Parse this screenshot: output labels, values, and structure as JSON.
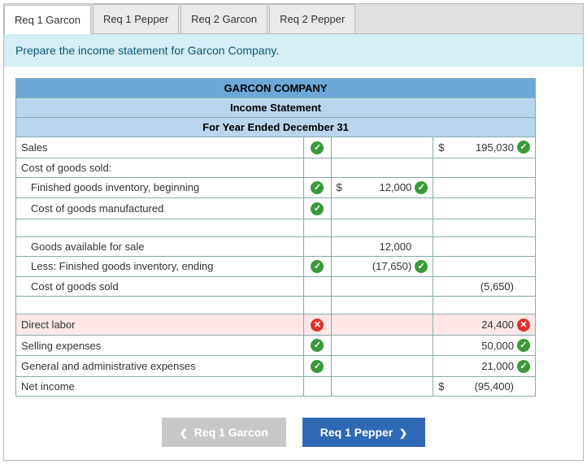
{
  "tabs": [
    {
      "label": "Req 1 Garcon",
      "active": true
    },
    {
      "label": "Req 1 Pepper",
      "active": false
    },
    {
      "label": "Req 2 Garcon",
      "active": false
    },
    {
      "label": "Req 2 Pepper",
      "active": false
    }
  ],
  "instruction": "Prepare the income statement for Garcon Company.",
  "header": {
    "company": "GARCON COMPANY",
    "title": "Income Statement",
    "period": "For Year Ended December 31"
  },
  "rows": {
    "sales": {
      "label": "Sales",
      "mark": "ok",
      "cur2": "$",
      "amt2": "195,030",
      "mark2": "ok"
    },
    "cogs_header": {
      "label": "Cost of goods sold:"
    },
    "fg_begin": {
      "label": "Finished goods inventory, beginning",
      "mark": "ok",
      "cur1": "$",
      "amt1": "12,000",
      "mark1": "ok"
    },
    "cogm": {
      "label": "Cost of goods manufactured",
      "mark": "ok"
    },
    "gafs": {
      "label": "Goods available for sale",
      "amt1": "12,000"
    },
    "fg_end": {
      "label": "Less: Finished goods inventory, ending",
      "mark": "ok",
      "amt1": "(17,650)",
      "mark1": "ok"
    },
    "cogs": {
      "label": "Cost of goods sold",
      "amt2": "(5,650)"
    },
    "direct_labor": {
      "label": "Direct labor",
      "mark": "bad",
      "amt2": "24,400",
      "mark2": "bad"
    },
    "selling": {
      "label": "Selling expenses",
      "mark": "ok",
      "amt2": "50,000",
      "mark2": "ok"
    },
    "ga": {
      "label": "General and administrative expenses",
      "mark": "ok",
      "amt2": "21,000",
      "mark2": "ok"
    },
    "net": {
      "label": "Net income",
      "cur2": "$",
      "amt2": "(95,400)"
    }
  },
  "nav": {
    "prev": "Req 1 Garcon",
    "next": "Req 1 Pepper"
  },
  "chart_data": {
    "type": "table",
    "title": "GARCON COMPANY Income Statement For Year Ended December 31",
    "data": [
      {
        "item": "Sales",
        "col1": null,
        "col2": 195030
      },
      {
        "item": "Finished goods inventory, beginning",
        "col1": 12000,
        "col2": null
      },
      {
        "item": "Cost of goods manufactured",
        "col1": null,
        "col2": null
      },
      {
        "item": "Goods available for sale",
        "col1": 12000,
        "col2": null
      },
      {
        "item": "Less: Finished goods inventory, ending",
        "col1": -17650,
        "col2": null
      },
      {
        "item": "Cost of goods sold",
        "col1": null,
        "col2": -5650
      },
      {
        "item": "Direct labor",
        "col1": null,
        "col2": 24400
      },
      {
        "item": "Selling expenses",
        "col1": null,
        "col2": 50000
      },
      {
        "item": "General and administrative expenses",
        "col1": null,
        "col2": 21000
      },
      {
        "item": "Net income",
        "col1": null,
        "col2": -95400
      }
    ]
  }
}
